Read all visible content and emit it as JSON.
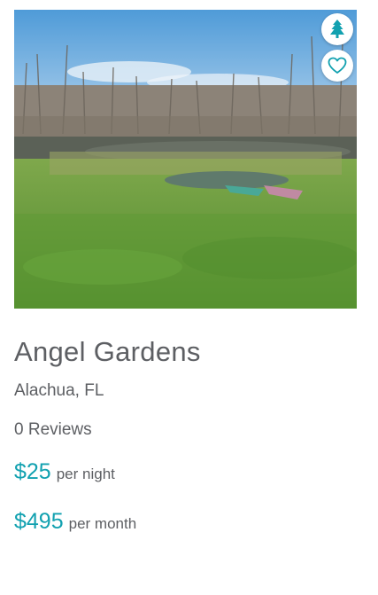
{
  "listing": {
    "title": "Angel Gardens",
    "location": "Alachua, FL",
    "reviews": "0 Reviews",
    "price_night": "$25",
    "price_night_unit": "per night",
    "price_month": "$495",
    "price_month_unit": "per month"
  },
  "icons": {
    "badge": "tree-icon",
    "favorite": "heart-icon"
  },
  "colors": {
    "accent": "#12a1b0",
    "text": "#5d5f63"
  }
}
